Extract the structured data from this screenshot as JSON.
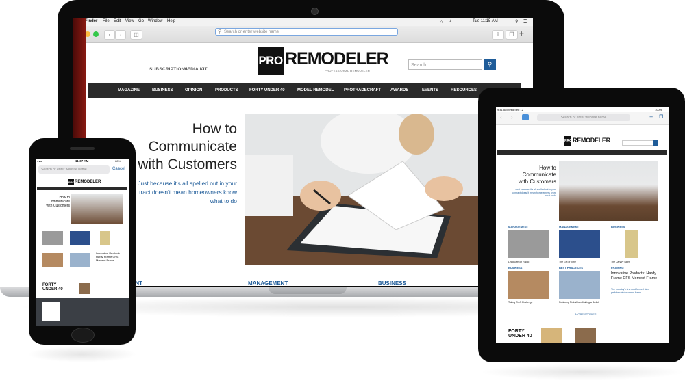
{
  "laptop": {
    "menubar": {
      "apple": "",
      "app": "Finder",
      "items": [
        "File",
        "Edit",
        "View",
        "Go",
        "Window",
        "Help"
      ],
      "clock": "Tue 11:15 AM"
    },
    "browser": {
      "url_placeholder": "Search or enter website name"
    },
    "site": {
      "utility_links": [
        "SUBSCRIPTIONS",
        "MEDIA KIT"
      ],
      "logo_pro": "PRO",
      "logo_remodeler": "REMODELER",
      "logo_tagline": "PROFESSIONAL REMODELER",
      "search_placeholder": "Search",
      "nav": [
        "MAGAZINE",
        "BUSINESS",
        "OPINION",
        "PRODUCTS",
        "FORTY UNDER 40",
        "MODEL REMODEL",
        "PROTRADECRAFT",
        "AWARDS",
        "EVENTS",
        "RESOURCES"
      ],
      "hero_title_lines": [
        "How to",
        "Communicate",
        "with Customers"
      ],
      "hero_sub_lines": [
        "Just because it's all spelled out in your",
        "tract doesn't mean homeowners know",
        "what to do"
      ],
      "sections": [
        "EMENT",
        "MANAGEMENT",
        "BUSINESS"
      ]
    }
  },
  "phone": {
    "clock": "11:37 AM",
    "battery": "68%",
    "url_placeholder": "Search or enter website name",
    "cancel": "Cancel",
    "logo_pro": "PRO",
    "logo_remodeler": "REMODELER",
    "hero_title_lines": [
      "How to",
      "Communicate",
      "with Customers"
    ],
    "card_titles": [
      "Innovative Products",
      "Hardy Frame CFS",
      "Moment Frame"
    ],
    "forty": "FORTY UNDER 40"
  },
  "tablet": {
    "clock": "9:41 AM",
    "date": "Wed Sep 12",
    "battery": "100%",
    "url_placeholder": "Search or enter website name",
    "logo_pro": "PRO",
    "logo_remodeler": "REMODELER",
    "hero_title_lines": [
      "How to",
      "Communicate",
      "with Customers"
    ],
    "hero_sub": "Just because it's all spelled out in your contract doesn't mean homeowners know what to do",
    "sections_row1": [
      "MANAGEMENT",
      "MANAGEMENT",
      "BUSINESS"
    ],
    "captions_row1": [
      "Lead Gen on Radio",
      "The Gift of Time",
      "The Canary Signs"
    ],
    "sections_row2": [
      "BUSINESS",
      "BEST PRACTICES",
      "FRAMING"
    ],
    "captions_row2": [
      "Taking On A Challenge",
      "Reducing Risk When Making a Switch"
    ],
    "feature_title": "Innovative Products: Hardy Frame CFS Moment Frame",
    "feature_sub": "The industry's first cold-formed steel prefabricated moment frame",
    "more_stories": "MORE STORIES",
    "forty": "FORTY UNDER 40"
  }
}
